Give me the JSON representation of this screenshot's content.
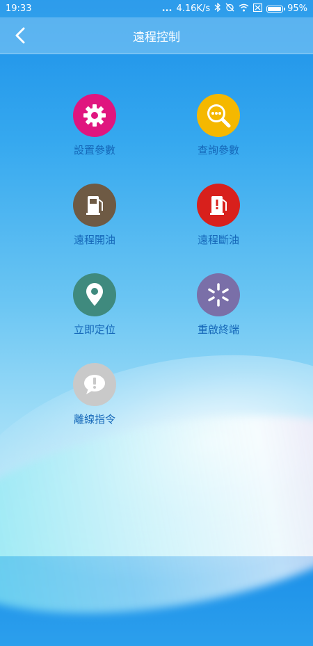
{
  "status": {
    "time": "19:33",
    "dots": "...",
    "speed": "4.16K/s",
    "battery": "95%",
    "battery_level": 0.95
  },
  "nav": {
    "title": "遠程控制"
  },
  "items": [
    {
      "label": "設置參數",
      "icon": "gear-icon",
      "color": "#e0157f"
    },
    {
      "label": "查詢參數",
      "icon": "search-dots-icon",
      "color": "#f5b800"
    },
    {
      "label": "遠程開油",
      "icon": "fuel-pump-icon",
      "color": "#6e5a44"
    },
    {
      "label": "遠程斷油",
      "icon": "fuel-pump-alert-icon",
      "color": "#d8201c"
    },
    {
      "label": "立即定位",
      "icon": "location-pin-icon",
      "color": "#3f8a7e"
    },
    {
      "label": "重啟終端",
      "icon": "restart-burst-icon",
      "color": "#7a6fa8"
    },
    {
      "label": "離線指令",
      "icon": "chat-alert-icon",
      "color": "#c9c9c9"
    }
  ]
}
